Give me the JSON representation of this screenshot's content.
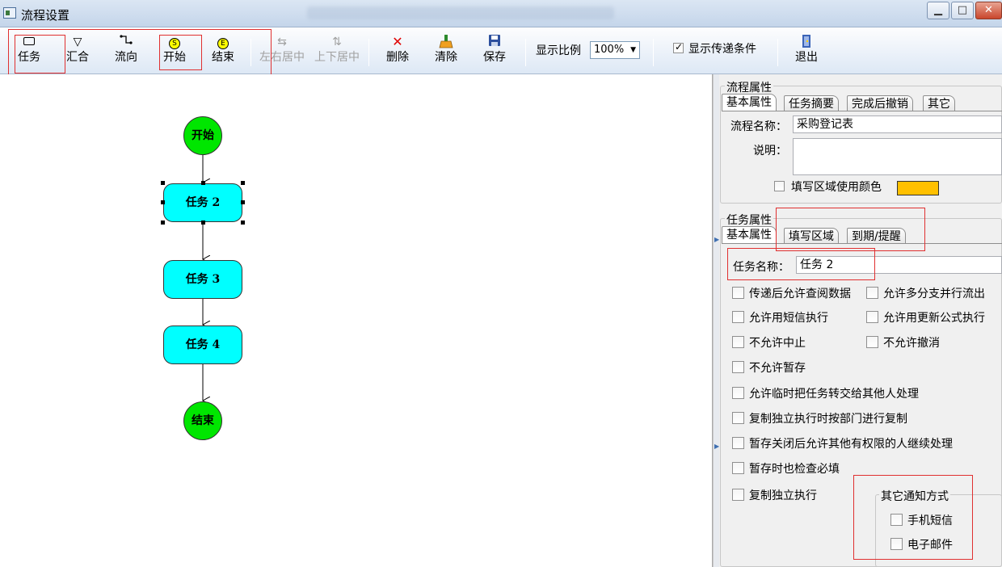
{
  "window": {
    "title": "流程设置",
    "min": "▁",
    "max": "□",
    "close": "✕"
  },
  "toolbar": {
    "task": "任务",
    "merge": "汇合",
    "flow": "流向",
    "start": "开始",
    "end": "结束",
    "hcenter": "左右居中",
    "vcenter": "上下居中",
    "delete": "删除",
    "clear": "清除",
    "save": "保存",
    "zoom_label": "显示比例",
    "zoom_value": "100%",
    "show_condition": "显示传递条件",
    "exit": "退出",
    "start_icon_letter": "S",
    "end_icon_letter": "E"
  },
  "diagram": {
    "start": "开始",
    "end": "结束",
    "tasks": [
      "任务 2",
      "任务 3",
      "任务 4"
    ],
    "colors": {
      "circle": "#00e600",
      "task": "#00ffff"
    }
  },
  "flow_props": {
    "title": "流程属性",
    "tabs": [
      "基本属性",
      "任务摘要",
      "完成后撤销",
      "其它"
    ],
    "name_label": "流程名称：",
    "name_value": "采购登记表",
    "desc_label": "说明：",
    "desc_value": "",
    "fill_color_label": "填写区域使用颜色",
    "fill_color": "#ffc000"
  },
  "task_props": {
    "title": "任务属性",
    "tabs": [
      "基本属性",
      "填写区域",
      "到期/提醒"
    ],
    "name_label": "任务名称：",
    "name_value": "任务 2",
    "options": [
      "传递后允许查阅数据",
      "允许多分支并行流出",
      "允许用短信执行",
      "允许用更新公式执行",
      "不允许中止",
      "不允许撤消",
      "不允许暂存",
      "允许临时把任务转交给其他人处理",
      "复制独立执行时按部门进行复制",
      "暂存关闭后允许其他有权限的人继续处理",
      "暂存时也检查必填",
      "复制独立执行"
    ],
    "notify": {
      "title": "其它通知方式",
      "sms": "手机短信",
      "email": "电子邮件"
    }
  }
}
